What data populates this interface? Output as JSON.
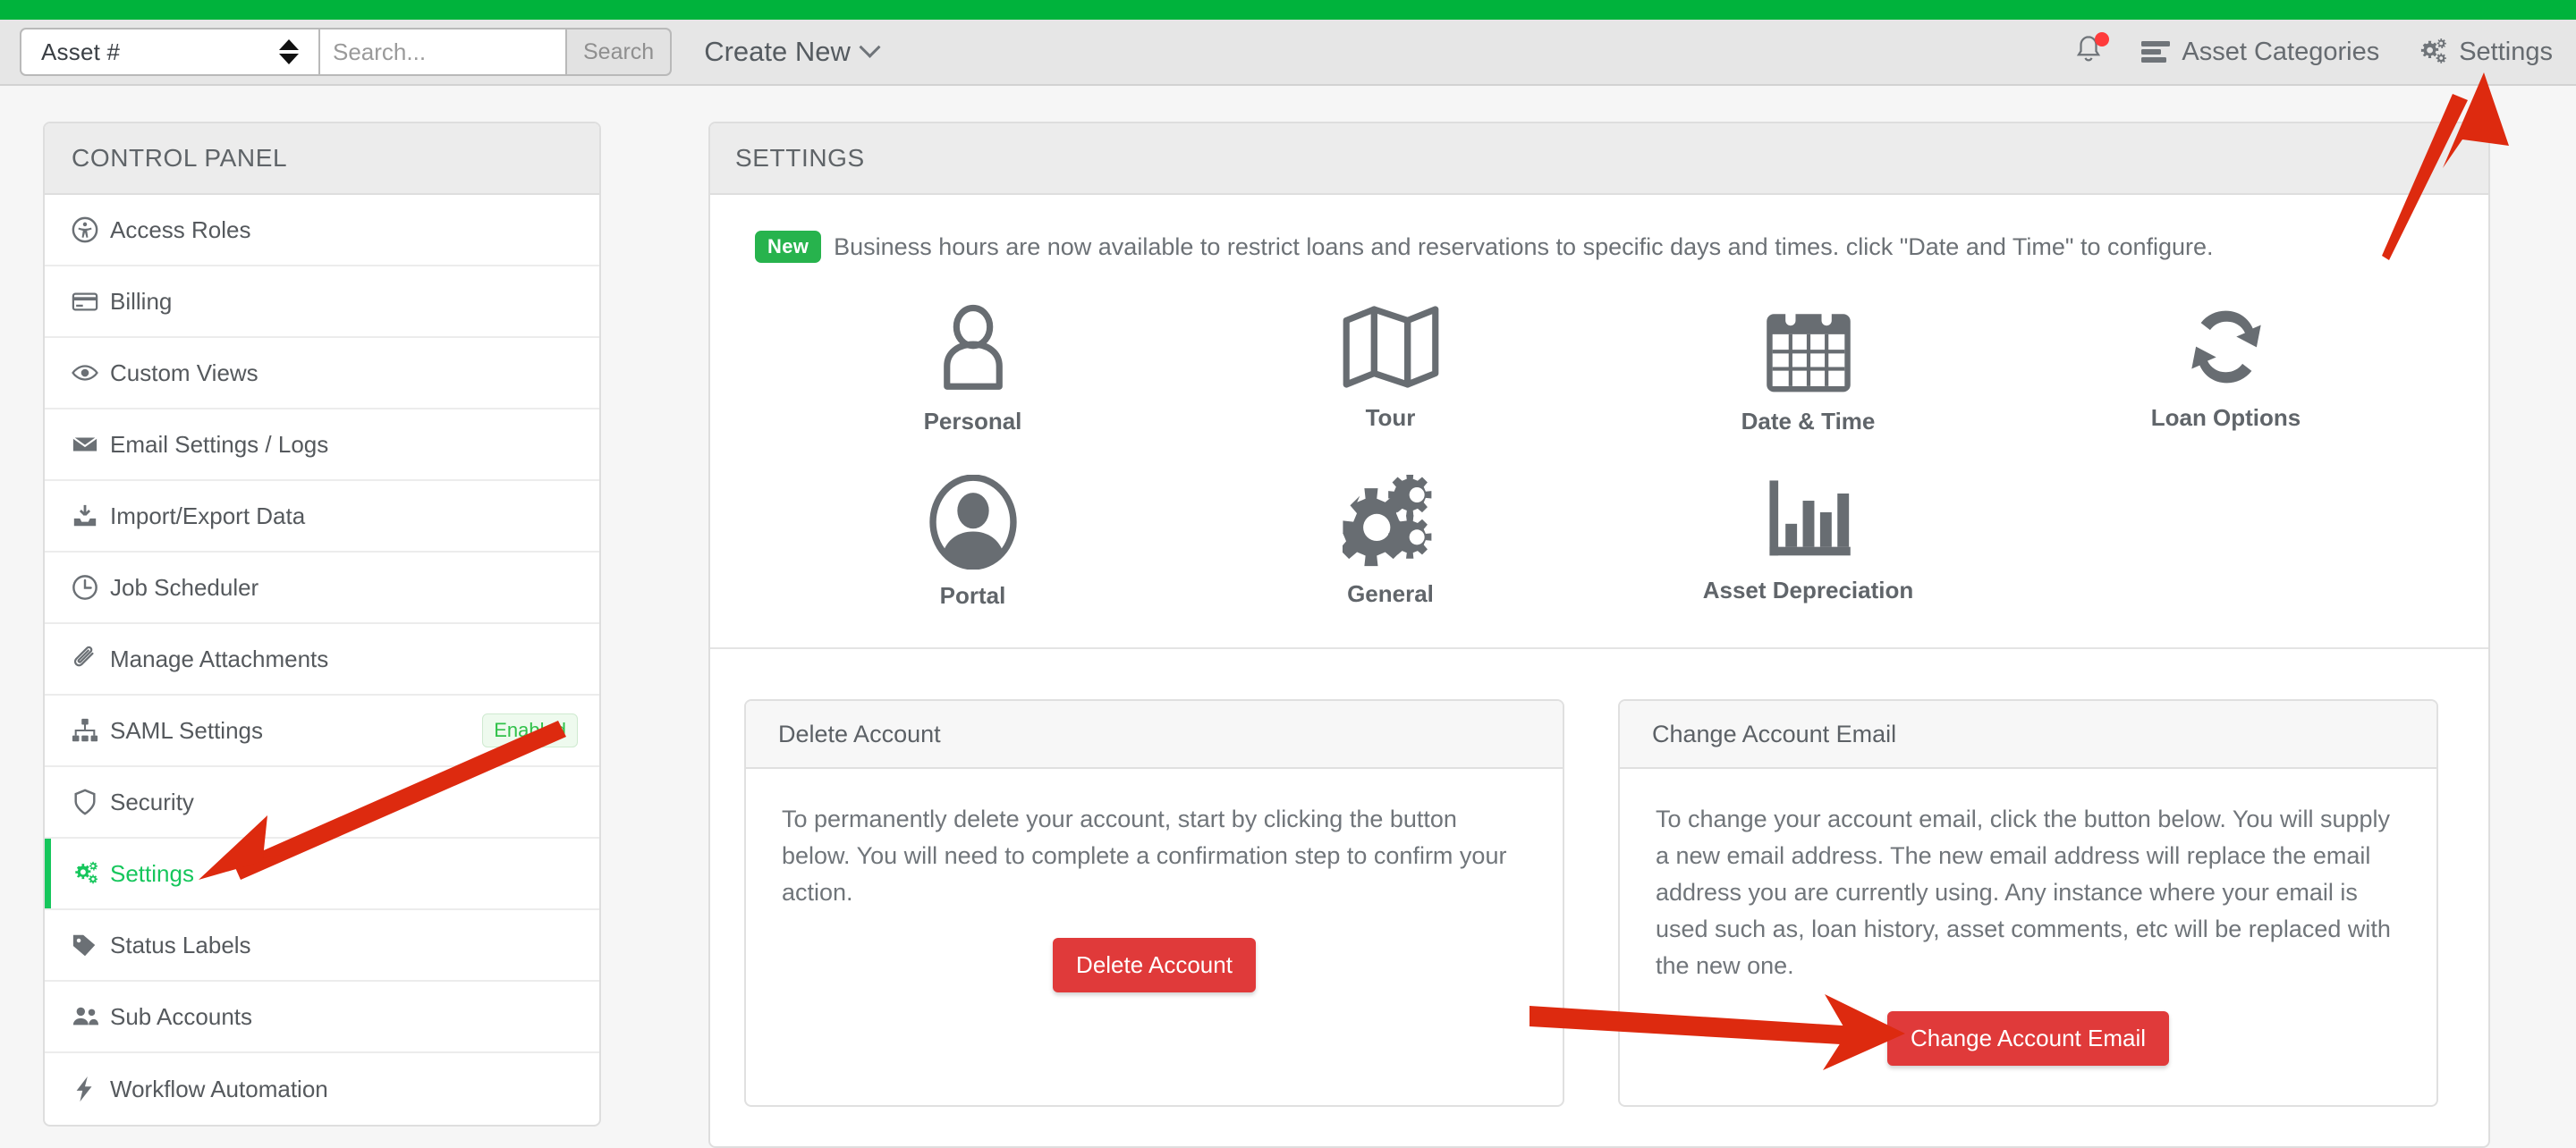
{
  "header": {
    "search_select_value": "Asset #",
    "search_placeholder": "Search...",
    "search_value": "",
    "search_button": "Search",
    "create_new": "Create New",
    "asset_categories": "Asset Categories",
    "settings": "Settings",
    "notification_badge": "",
    "accent_green": "#00b33c",
    "bar_bg": "#e6e6e6"
  },
  "sidebar": {
    "title": "CONTROL PANEL",
    "items": [
      {
        "label": "Access Roles",
        "icon": "universal-access-icon",
        "active": false,
        "badge": ""
      },
      {
        "label": "Billing",
        "icon": "credit-card-icon",
        "active": false,
        "badge": ""
      },
      {
        "label": "Custom Views",
        "icon": "eye-icon",
        "active": false,
        "badge": ""
      },
      {
        "label": "Email Settings / Logs",
        "icon": "envelope-icon",
        "active": false,
        "badge": ""
      },
      {
        "label": "Import/Export Data",
        "icon": "download-inbox-icon",
        "active": false,
        "badge": ""
      },
      {
        "label": "Job Scheduler",
        "icon": "clock-icon",
        "active": false,
        "badge": ""
      },
      {
        "label": "Manage Attachments",
        "icon": "paperclip-icon",
        "active": false,
        "badge": ""
      },
      {
        "label": "SAML Settings",
        "icon": "sitemap-icon",
        "active": false,
        "badge": "Enabled"
      },
      {
        "label": "Security",
        "icon": "shield-icon",
        "active": false,
        "badge": ""
      },
      {
        "label": "Settings",
        "icon": "gears-icon",
        "active": true,
        "badge": ""
      },
      {
        "label": "Status Labels",
        "icon": "tag-icon",
        "active": false,
        "badge": ""
      },
      {
        "label": "Sub Accounts",
        "icon": "users-icon",
        "active": false,
        "badge": ""
      },
      {
        "label": "Workflow Automation",
        "icon": "bolt-icon",
        "active": false,
        "badge": ""
      }
    ],
    "active_color": "#16c65c",
    "badge_color": "#31c14a"
  },
  "main": {
    "title": "SETTINGS",
    "notice": {
      "pill": "New",
      "text": "Business hours are now available to restrict loans and reservations to specific days and times. click \"Date and Time\" to configure."
    },
    "tiles": [
      {
        "label": "Personal",
        "icon": "person-outline-icon"
      },
      {
        "label": "Tour",
        "icon": "map-icon"
      },
      {
        "label": "Date & Time",
        "icon": "calendar-icon"
      },
      {
        "label": "Loan Options",
        "icon": "refresh-cycle-icon"
      },
      {
        "label": "Portal",
        "icon": "user-circle-icon"
      },
      {
        "label": "General",
        "icon": "gears-icon"
      },
      {
        "label": "Asset Depreciation",
        "icon": "bar-chart-icon"
      }
    ],
    "cards": [
      {
        "title": "Delete Account",
        "body": "To permanently delete your account, start by clicking the button below. You will need to complete a confirmation step to confirm your action.",
        "button": "Delete Account"
      },
      {
        "title": "Change Account Email",
        "body": "To change your account email, click the button below. You will supply a new email address. The new email address will replace the email address you are currently using. Any instance where your email is used such as, loan history, asset comments, etc will be replaced with the new one.",
        "button": "Change Account Email"
      }
    ],
    "danger_color": "#e03a3a"
  },
  "annotations": {
    "arrow_color": "#dd2a0f",
    "arrows": [
      {
        "name": "arrow-to-header-settings"
      },
      {
        "name": "arrow-to-sidebar-settings"
      },
      {
        "name": "arrow-to-change-account-email-button"
      }
    ]
  }
}
